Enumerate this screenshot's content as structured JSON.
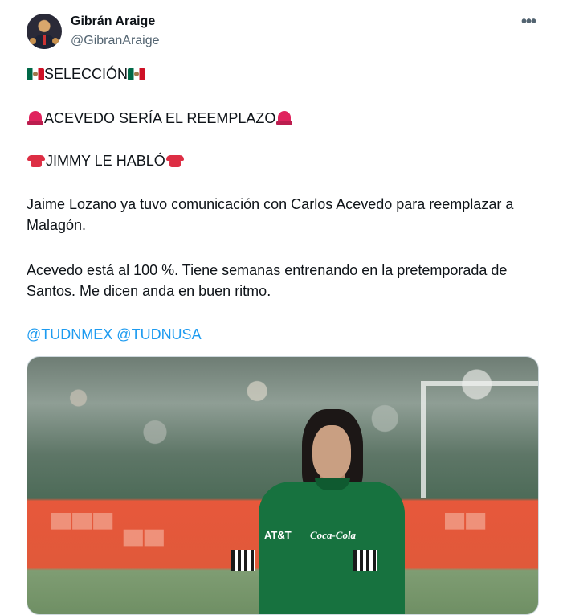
{
  "author": {
    "name": "Gibrán Araige",
    "handle": "@GibranAraige"
  },
  "more_label": "•••",
  "lines": {
    "seleccion": "SELECCIÓN",
    "reemplazo": "ACEVEDO SERÍA EL REEMPLAZO",
    "jimmy": "JIMMY LE HABLÓ"
  },
  "paragraphs": {
    "p1": "Jaime Lozano ya tuvo comunicación con Carlos Acevedo para reemplazar a Malagón.",
    "p2": "Acevedo está al 100 %. Tiene semanas entrenando en la pretemporada de Santos. Me dicen anda en buen ritmo."
  },
  "mentions": [
    "@TUDNMEX",
    "@TUDNUSA"
  ],
  "media": {
    "sponsor_left": "AT&T",
    "sponsor_right": "Coca-Cola"
  },
  "icons": {
    "flag": "mexico-flag-icon",
    "siren": "police-siren-icon",
    "phone": "telephone-icon",
    "more": "more-options-icon"
  },
  "colors": {
    "text": "#0f1419",
    "secondary": "#536471",
    "link": "#1d9bf0"
  }
}
